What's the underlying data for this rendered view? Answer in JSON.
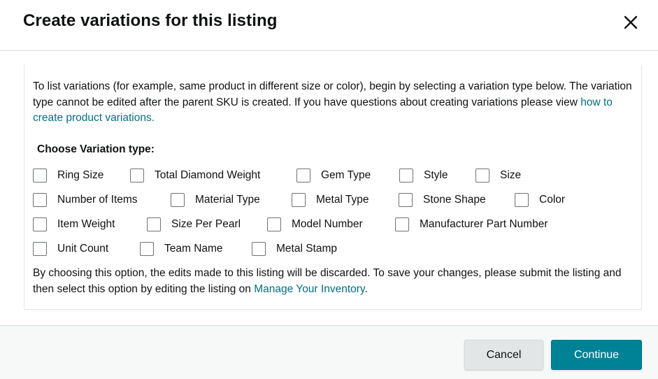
{
  "dialog": {
    "title": "Create variations for this listing"
  },
  "intro": {
    "text": "To list variations (for example, same product in different size or color), begin by selecting a variation type below. The variation type cannot be edited after the parent SKU is created. If you have questions about creating variations please view ",
    "link": "how to create product variations."
  },
  "variation": {
    "heading": "Choose Variation type:",
    "rows": [
      [
        {
          "label": "Ring Size",
          "checked": false
        },
        {
          "label": "Total Diamond Weight",
          "checked": false
        },
        {
          "label": "Gem Type",
          "checked": false
        },
        {
          "label": "Style",
          "checked": false
        },
        {
          "label": "Size",
          "checked": false
        }
      ],
      [
        {
          "label": "Number of Items",
          "checked": false
        },
        {
          "label": "Material Type",
          "checked": false
        },
        {
          "label": "Metal Type",
          "checked": false
        },
        {
          "label": "Stone Shape",
          "checked": false
        },
        {
          "label": "Color",
          "checked": false
        }
      ],
      [
        {
          "label": "Item Weight",
          "checked": false
        },
        {
          "label": "Size Per Pearl",
          "checked": false
        },
        {
          "label": "Model Number",
          "checked": false
        },
        {
          "label": "Manufacturer Part Number",
          "checked": false
        }
      ],
      [
        {
          "label": "Unit Count",
          "checked": false
        },
        {
          "label": "Team Name",
          "checked": false
        },
        {
          "label": "Metal Stamp",
          "checked": false
        }
      ]
    ]
  },
  "note": {
    "text": "By choosing this option, the edits made to this listing will be discarded. To save your changes, please submit the listing and then select this option by editing the listing on ",
    "link": "Manage Your Inventory",
    "suffix": "."
  },
  "footer": {
    "cancel_label": "Cancel",
    "continue_label": "Continue"
  },
  "icons": {
    "close": "close-icon"
  },
  "colors": {
    "link": "#007185",
    "primary": "#008296"
  }
}
